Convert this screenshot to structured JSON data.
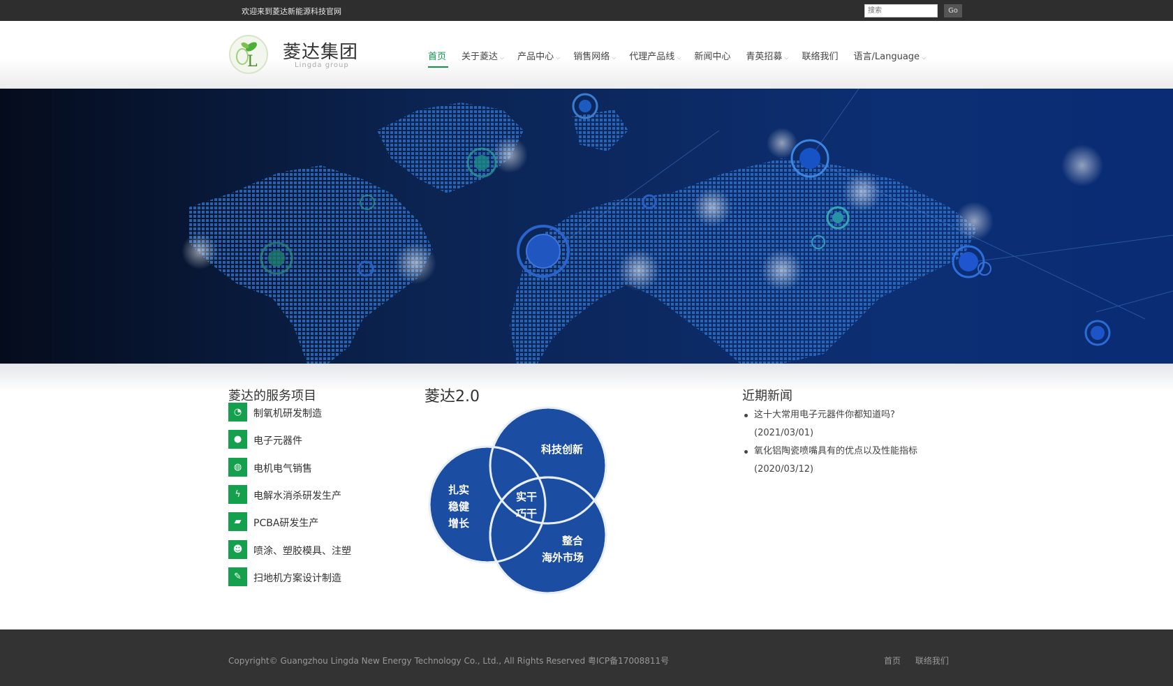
{
  "topbar": {
    "welcome": "欢迎来到菱达新能源科技官网",
    "search_placeholder": "搜索",
    "go_label": "Go"
  },
  "brand": {
    "name": "菱达集团",
    "subtitle": "Lingda group",
    "logo_letter": "L"
  },
  "nav": {
    "items": [
      {
        "label": "首页",
        "caret": ""
      },
      {
        "label": "关于菱达",
        "caret": "⌵"
      },
      {
        "label": "产品中心",
        "caret": "⌵"
      },
      {
        "label": "销售网络",
        "caret": "⌵"
      },
      {
        "label": "代理产品线",
        "caret": "⌵"
      },
      {
        "label": "新闻中心",
        "caret": ""
      },
      {
        "label": "青英招募",
        "caret": "⌵"
      },
      {
        "label": "联络我们",
        "caret": ""
      },
      {
        "label": "语言/Language",
        "caret": "⌵"
      }
    ]
  },
  "services": {
    "title": "菱达的服务项目",
    "items": [
      {
        "icon": "pie-chart-icon",
        "glyph": "◔",
        "label": "制氧机研发制造"
      },
      {
        "icon": "comment-icon",
        "glyph": "●",
        "label": "电子元器件"
      },
      {
        "icon": "comments-icon",
        "glyph": "◍",
        "label": "电机电气销售"
      },
      {
        "icon": "bolt-icon",
        "glyph": "ϟ",
        "label": "电解水消杀研发生产"
      },
      {
        "icon": "truck-icon",
        "glyph": "▰",
        "label": "PCBA研发生产"
      },
      {
        "icon": "users-icon",
        "glyph": "☻",
        "label": "喷涂、塑胶模具、注塑"
      },
      {
        "icon": "edit-icon",
        "glyph": "✎",
        "label": "扫地机方案设计制造"
      }
    ]
  },
  "lingda2": {
    "title": "菱达2.0",
    "circles": {
      "top": "科技创新",
      "left": [
        "扎实",
        "稳健",
        "增长"
      ],
      "bottom": [
        "整合",
        "海外市场"
      ],
      "center": [
        "实干",
        "巧干"
      ]
    },
    "circle_color": "#1b4ea3"
  },
  "news": {
    "title": "近期新闻",
    "items": [
      {
        "title": "这十大常用电子元器件你都知道吗?",
        "date": "(2021/03/01)"
      },
      {
        "title": "氧化铝陶瓷喷嘴具有的优点以及性能指标",
        "date": "(2020/03/12)"
      }
    ]
  },
  "footer": {
    "copyright": "Copyright© Guangzhou Lingda New Energy Technology Co., Ltd., All Rights Reserved 粤ICP备17008811号",
    "links": [
      "首页",
      "联络我们"
    ]
  },
  "colors": {
    "accent_green": "#14a04c",
    "nav_active": "#0a9a4a",
    "dark_bar": "#2e2e2e",
    "venn_blue": "#1b4ea3"
  }
}
